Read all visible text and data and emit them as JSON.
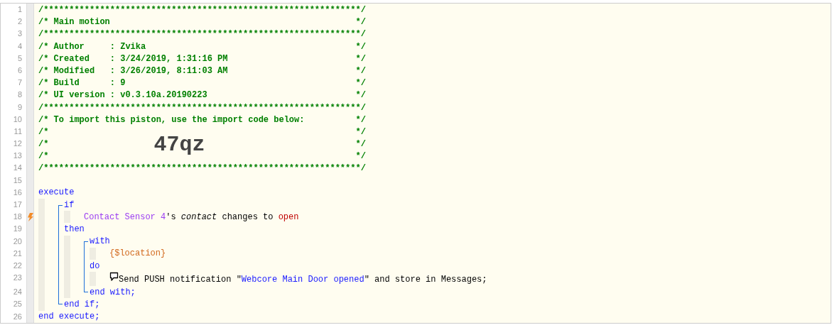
{
  "header": [
    {
      "number": "1",
      "text": "/**************************************************************/"
    },
    {
      "number": "2",
      "text": "/* Main motion",
      "close": "*/"
    },
    {
      "number": "3",
      "text": "/**************************************************************/"
    },
    {
      "number": "4",
      "text": "/* Author     : Zvika",
      "close": "*/"
    },
    {
      "number": "5",
      "text": "/* Created    : 3/24/2019, 1:31:16 PM",
      "close": "*/"
    },
    {
      "number": "6",
      "text": "/* Modified   : 3/26/2019, 8:11:03 AM",
      "close": "*/"
    },
    {
      "number": "7",
      "text": "/* Build      : 9",
      "close": "*/"
    },
    {
      "number": "8",
      "text": "/* UI version : v0.3.10a.20190223",
      "close": "*/"
    },
    {
      "number": "9",
      "text": "/**************************************************************/"
    },
    {
      "number": "10",
      "text": "/* To import this piston, use the import code below:",
      "close": "*/"
    },
    {
      "number": "11",
      "text": "/*",
      "close": "*/"
    },
    {
      "number": "12",
      "text": "/*",
      "code": "47qz",
      "close": "*/"
    },
    {
      "number": "13",
      "text": "/*",
      "close": "*/"
    },
    {
      "number": "14",
      "text": "/**************************************************************/"
    },
    {
      "number": "15"
    }
  ],
  "program": [
    {
      "kind": "line",
      "number": "16",
      "segments": [
        {
          "kind": "keyword",
          "text": "execute"
        }
      ],
      "children": [
        {
          "kind": "group",
          "children": [
            {
              "kind": "line",
              "number": "17",
              "segments": [
                {
                  "kind": "keyword",
                  "text": "if"
                }
              ],
              "children": [
                {
                  "kind": "line",
                  "number": "18",
                  "trigger": true,
                  "segments": [
                    {
                      "kind": "device",
                      "text": "Contact Sensor 4"
                    },
                    {
                      "kind": "text",
                      "text": "'s "
                    },
                    {
                      "kind": "attribute",
                      "text": "contact"
                    },
                    {
                      "kind": "text",
                      "text": " changes to "
                    },
                    {
                      "kind": "value",
                      "text": "open"
                    }
                  ]
                }
              ]
            },
            {
              "kind": "line",
              "number": "19",
              "segments": [
                {
                  "kind": "keyword",
                  "text": "then"
                }
              ],
              "children": [
                {
                  "kind": "group",
                  "children": [
                    {
                      "kind": "line",
                      "number": "20",
                      "segments": [
                        {
                          "kind": "keyword",
                          "text": "with"
                        }
                      ],
                      "children": [
                        {
                          "kind": "line",
                          "number": "21",
                          "segments": [
                            {
                              "kind": "variable",
                              "text": "{$location}"
                            }
                          ]
                        }
                      ]
                    },
                    {
                      "kind": "line",
                      "number": "22",
                      "segments": [
                        {
                          "kind": "keyword",
                          "text": "do"
                        }
                      ],
                      "children": [
                        {
                          "kind": "action",
                          "number": "23",
                          "segments": [
                            {
                              "kind": "text",
                              "text": "Send PUSH notification \""
                            },
                            {
                              "kind": "string",
                              "text": "Webcore Main Door opened"
                            },
                            {
                              "kind": "text",
                              "text": "\" and store in Messages;"
                            }
                          ]
                        }
                      ]
                    },
                    {
                      "kind": "line",
                      "number": "24",
                      "segments": [
                        {
                          "kind": "keyword",
                          "text": "end with;"
                        }
                      ]
                    }
                  ]
                }
              ]
            },
            {
              "kind": "line",
              "number": "25",
              "segments": [
                {
                  "kind": "keyword",
                  "text": "end if;"
                }
              ]
            }
          ]
        }
      ]
    },
    {
      "kind": "line",
      "number": "26",
      "segments": [
        {
          "kind": "keyword",
          "text": "end execute;"
        }
      ]
    }
  ]
}
